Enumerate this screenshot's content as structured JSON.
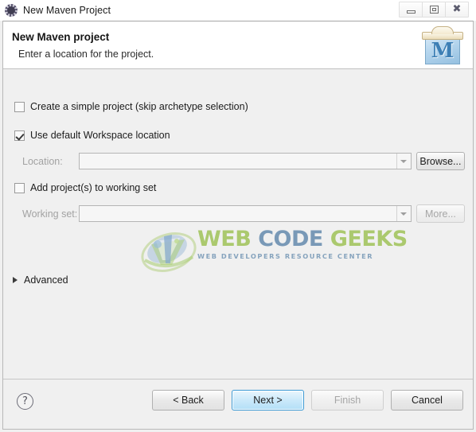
{
  "titlebar": {
    "title": "New Maven Project",
    "icon": "eclipse-icon",
    "minimize_label": "Minimize",
    "maximize_label": "Restore",
    "close_glyph": "✖"
  },
  "header": {
    "title": "New Maven project",
    "subtitle": "Enter a location for the project.",
    "logo_letter": "M",
    "logo_name": "maven-logo"
  },
  "form": {
    "simple_project": {
      "label": "Create a simple project (skip archetype selection)",
      "checked": false
    },
    "default_workspace": {
      "label": "Use default Workspace location",
      "checked": true
    },
    "location": {
      "label": "Location:",
      "value": "",
      "placeholder": "",
      "browse_label": "Browse...",
      "enabled": false
    },
    "working_set_checkbox": {
      "label": "Add project(s) to working set",
      "checked": false
    },
    "working_set": {
      "label": "Working set:",
      "value": "",
      "placeholder": "",
      "more_label": "More...",
      "enabled": false
    },
    "advanced": {
      "label": "Advanced",
      "expanded": false
    }
  },
  "watermark": {
    "word1": "WEB",
    "word2": "CODE",
    "word3": "GEEKS",
    "subtitle": "WEB DEVELOPERS RESOURCE CENTER"
  },
  "footer": {
    "help_glyph": "?",
    "back_label": "< Back",
    "next_label": "Next >",
    "finish_label": "Finish",
    "cancel_label": "Cancel"
  },
  "colors": {
    "window_bg": "#f0f0f0",
    "header_bg": "#ffffff",
    "default_button_border": "#3c9ad4",
    "wm_green": "#9cc152",
    "wm_blue": "#5f87ab"
  }
}
